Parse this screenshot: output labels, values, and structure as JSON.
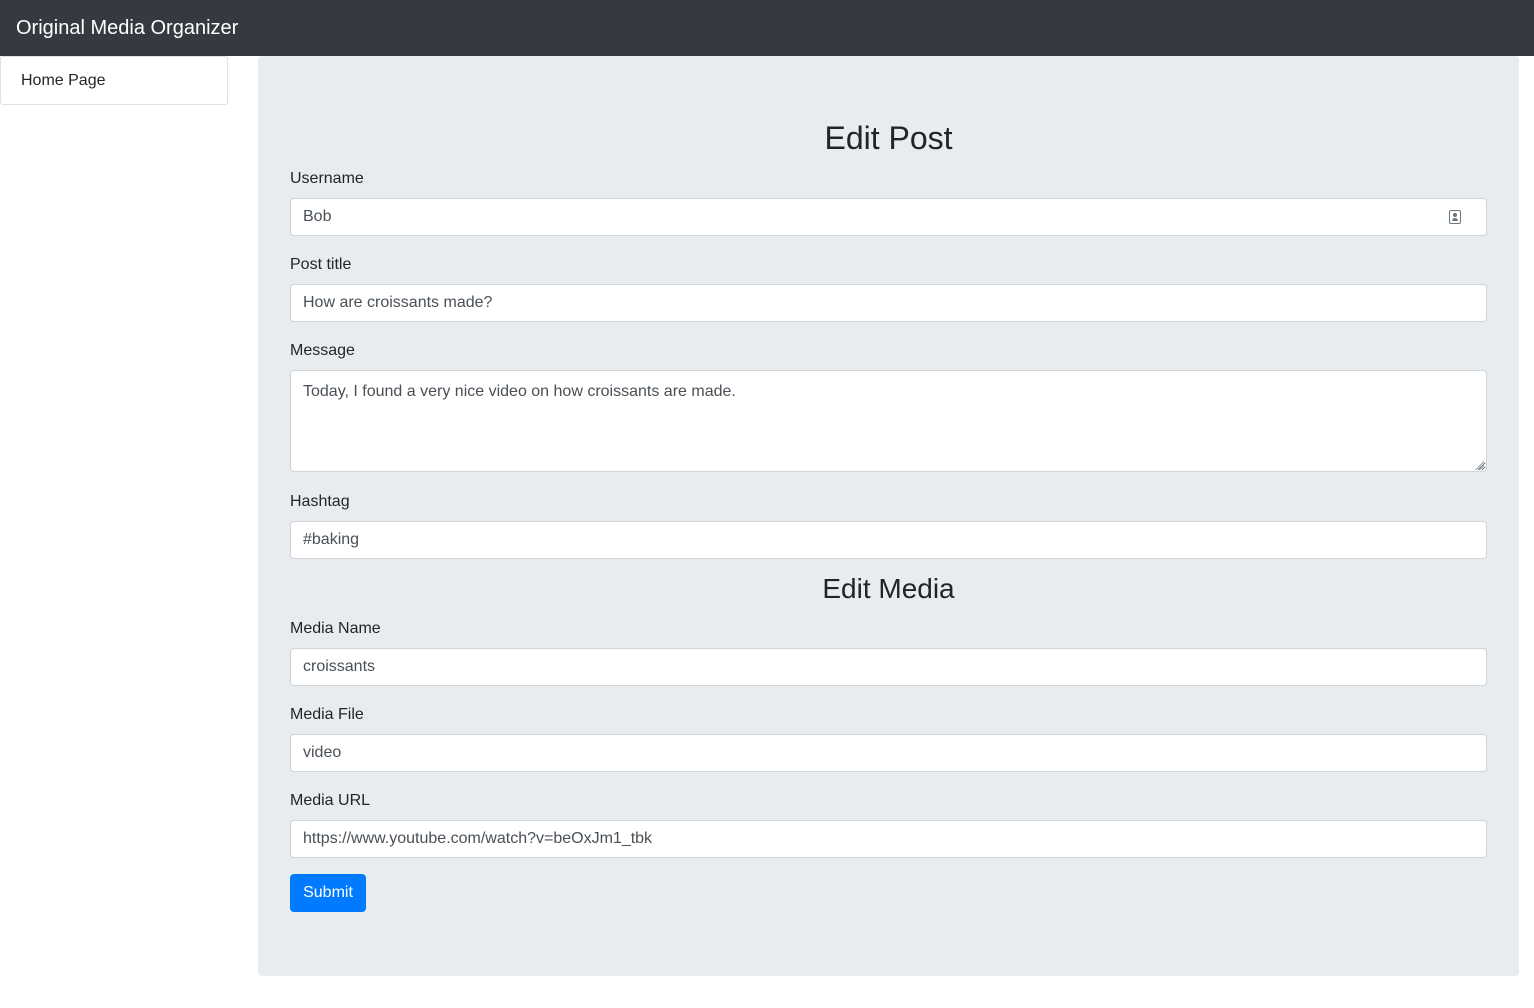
{
  "navbar": {
    "brand": "Original Media Organizer"
  },
  "sidebar": {
    "items": [
      {
        "label": "Home Page"
      }
    ]
  },
  "post": {
    "heading": "Edit Post",
    "username": {
      "label": "Username",
      "value": "Bob",
      "icon": "contact-card-icon"
    },
    "post_title": {
      "label": "Post title",
      "value": "How are croissants made?"
    },
    "message": {
      "label": "Message",
      "value": "Today, I found a very nice video on how croissants are made."
    },
    "hashtag": {
      "label": "Hashtag",
      "value": "#baking"
    }
  },
  "media": {
    "heading": "Edit Media",
    "name": {
      "label": "Media Name",
      "value": "croissants"
    },
    "file": {
      "label": "Media File",
      "value": "video"
    },
    "url": {
      "label": "Media URL",
      "value": "https://www.youtube.com/watch?v=beOxJm1_tbk"
    }
  },
  "form": {
    "submit_label": "Submit"
  },
  "colors": {
    "navbar_bg": "#343a40",
    "content_bg": "#e9ecef",
    "primary": "#007bff"
  }
}
